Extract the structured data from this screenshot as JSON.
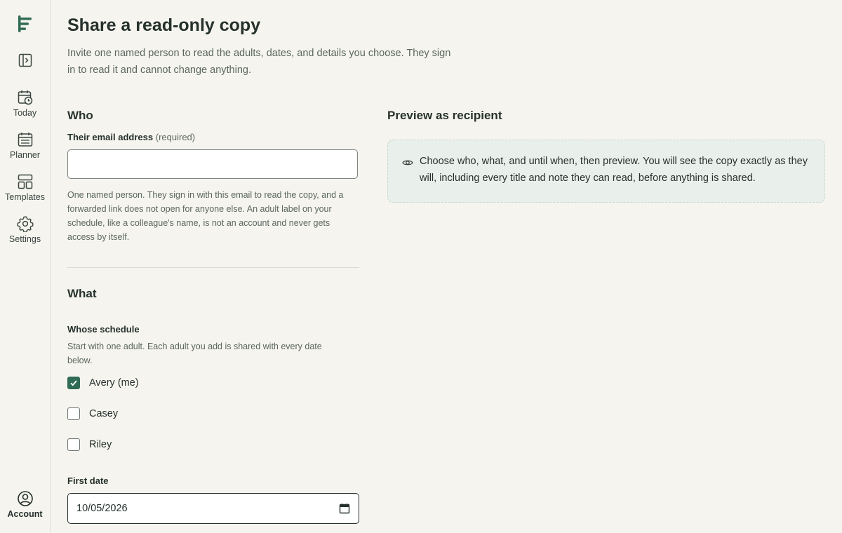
{
  "nav": {
    "logo_icon": "app-logo-icon",
    "toggle_icon": "sidebar-toggle-icon",
    "items": [
      {
        "label": "Today",
        "icon": "calendar-clock-icon"
      },
      {
        "label": "Planner",
        "icon": "calendar-grid-icon"
      },
      {
        "label": "Templates",
        "icon": "layout-icon"
      },
      {
        "label": "Settings",
        "icon": "gear-icon"
      }
    ],
    "account": {
      "label": "Account",
      "icon": "user-circle-icon"
    }
  },
  "page": {
    "title": "Share a read-only copy",
    "intro": "Invite one named person to read the adults, dates, and details you choose. They sign in to read it and cannot change anything."
  },
  "who": {
    "heading": "Who",
    "email_label": "Their email address",
    "email_required": "(required)",
    "email_value": "",
    "help": "One named person. They sign in with this email to read the copy, and a forwarded link does not open for anyone else. An adult label on your schedule, like a colleague's name, is not an account and never gets access by itself."
  },
  "what": {
    "heading": "What",
    "whose_label": "Whose schedule",
    "whose_help": "Start with one adult. Each adult you add is shared with every date below.",
    "adults": [
      {
        "label": "Avery (me)",
        "checked": true
      },
      {
        "label": "Casey",
        "checked": false
      },
      {
        "label": "Riley",
        "checked": false
      }
    ],
    "first_date_label": "First date",
    "first_date_value": "10/05/2026"
  },
  "preview": {
    "heading": "Preview as recipient",
    "icon": "eye-icon",
    "text": "Choose who, what, and until when, then preview. You will see the copy exactly as they will, including every title and note they can read, before anything is shared."
  },
  "colors": {
    "accent": "#2f6b55",
    "background": "#f5f4ef",
    "preview_bg": "#e9efea"
  }
}
